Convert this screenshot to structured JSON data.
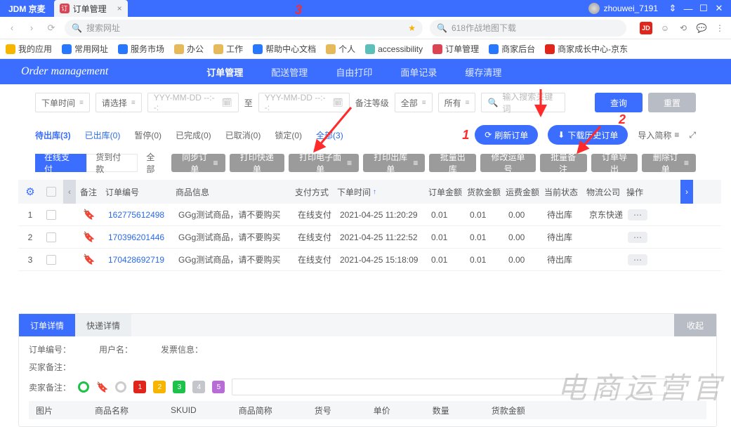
{
  "titlebar": {
    "logo": "JDM 京麦",
    "tab_label": "订单管理",
    "user": "zhouwei_7191"
  },
  "addrbar": {
    "search_placeholder": "搜索网址",
    "mini_placeholder": "618作战地图下载",
    "jd_label": "JD"
  },
  "bookmarks": [
    "我的应用",
    "常用网址",
    "服务市场",
    "办公",
    "工作",
    "帮助中心文档",
    "个人",
    "accessibility",
    "订单管理",
    "商家后台",
    "商家成长中心-京东"
  ],
  "bluenav": {
    "brand": "Order management",
    "items": [
      "订单管理",
      "配送管理",
      "自由打印",
      "面单记录",
      "缓存清理"
    ]
  },
  "filters": {
    "time_label": "下单时间",
    "select_label": "请选择",
    "date_placeholder": "YYY-MM-DD --:--:",
    "to": "至",
    "note_label": "备注等级",
    "all": "全部",
    "all2": "所有",
    "search_placeholder": "输入搜索关键词",
    "query": "查询",
    "reset": "重置"
  },
  "status_tabs": [
    "待出库(3)",
    "已出库(0)",
    "暂停(0)",
    "已完成(0)",
    "已取消(0)",
    "锁定(0)",
    "全部(3)"
  ],
  "pill_refresh": "刷新订单",
  "pill_download": "下载历史订单",
  "import_label": "导入简称",
  "annotation1": "1",
  "annotation2": "2",
  "annotation3": "3",
  "subtabs": [
    "在线支付",
    "货到付款",
    "全部"
  ],
  "grey_buttons": [
    "同步订单",
    "打印快递单",
    "打印电子面单",
    "打印出库单",
    "批量出库",
    "修改运单号",
    "批量备注",
    "订单导出",
    "删除订单"
  ],
  "table": {
    "headers": {
      "note": "备注",
      "order": "订单编号",
      "product": "商品信息",
      "pay": "支付方式",
      "time": "下单时间",
      "amt": "订单金额",
      "col2": "货款金额",
      "ship": "运费金额",
      "stat": "当前状态",
      "log": "物流公司",
      "op": "操作"
    },
    "rows": [
      {
        "idx": "1",
        "order": "162775612498",
        "product": "GGg测试商品，请不要购买",
        "pay": "在线支付",
        "time": "2021-04-25 11:20:29",
        "amt": "0.01",
        "col2": "0.01",
        "ship": "0.00",
        "stat": "待出库",
        "log": "京东快递"
      },
      {
        "idx": "2",
        "order": "170396201446",
        "product": "GGg测试商品，请不要购买",
        "pay": "在线支付",
        "time": "2021-04-25 11:22:52",
        "amt": "0.01",
        "col2": "0.01",
        "ship": "0.00",
        "stat": "待出库",
        "log": ""
      },
      {
        "idx": "3",
        "order": "170428692719",
        "product": "GGg测试商品，请不要购买",
        "pay": "在线支付",
        "time": "2021-04-25 15:18:09",
        "amt": "0.01",
        "col2": "0.01",
        "ship": "0.00",
        "stat": "待出库",
        "log": ""
      }
    ]
  },
  "detail": {
    "tabs": [
      "订单详情",
      "快递详情"
    ],
    "collapse": "收起",
    "order_no": "订单编号：",
    "user": "用户名：",
    "invoice": "发票信息：",
    "buyer_note": "买家备注：",
    "seller_note": "卖家备注：",
    "bottom_headers": [
      "图片",
      "商品名称",
      "SKUID",
      "商品简称",
      "货号",
      "单价",
      "数量",
      "货款金额"
    ],
    "tag_numbers": [
      "1",
      "2",
      "3",
      "4",
      "5"
    ]
  },
  "watermark": "电商运营官"
}
